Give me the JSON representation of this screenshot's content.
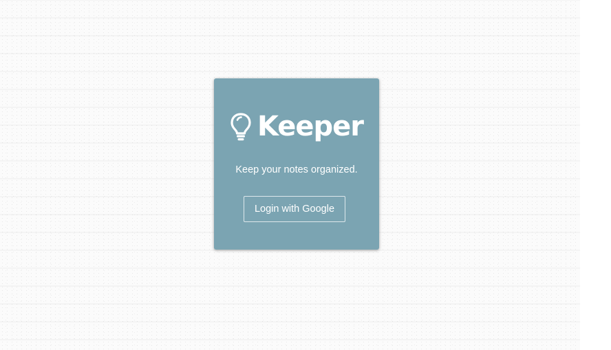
{
  "app": {
    "name": "Keeper",
    "tagline": "Keep your notes organized.",
    "login_button_label": "Login with Google",
    "logo_icon": "lightbulb-icon"
  },
  "colors": {
    "card_background": "#7ba4b2",
    "page_background": "#fbfbfb",
    "text": "#ffffff"
  }
}
